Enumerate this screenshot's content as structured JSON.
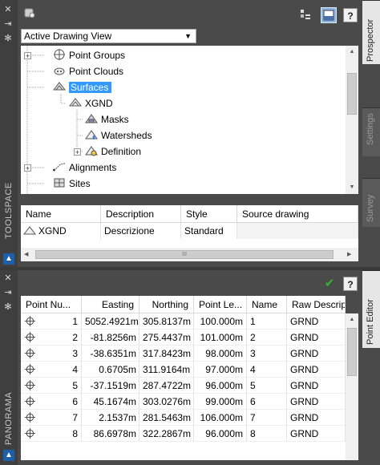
{
  "toolspace": {
    "side_label": "TOOLSPACE",
    "view_select": "Active Drawing View",
    "tabs": [
      "Prospector",
      "Settings",
      "Survey"
    ],
    "tree": [
      {
        "label": "Point Groups",
        "icon": "point-groups-icon"
      },
      {
        "label": "Point Clouds",
        "icon": "point-clouds-icon"
      },
      {
        "label": "Surfaces",
        "icon": "surfaces-icon",
        "selected": true
      },
      {
        "label": "XGND",
        "icon": "surface-icon"
      },
      {
        "label": "Masks",
        "icon": "masks-icon"
      },
      {
        "label": "Watersheds",
        "icon": "watersheds-icon"
      },
      {
        "label": "Definition",
        "icon": "definition-icon"
      },
      {
        "label": "Alignments",
        "icon": "alignments-icon"
      },
      {
        "label": "Sites",
        "icon": "sites-icon"
      }
    ],
    "list": {
      "headers": [
        "Name",
        "Description",
        "Style",
        "Source drawing"
      ],
      "row": {
        "name": "XGND",
        "description": "Descrizione",
        "style": "Standard",
        "source": ""
      }
    }
  },
  "panorama": {
    "side_label": "PANORAMA",
    "tab": "Point Editor",
    "headers": [
      "Point Nu...",
      "Easting",
      "Northing",
      "Point Le...",
      "Name",
      "Raw Descript"
    ],
    "rows": [
      [
        "1",
        "5052.4921m",
        "305.8137m",
        "100.000m",
        "1",
        "GRND"
      ],
      [
        "2",
        "-81.8256m",
        "275.4437m",
        "101.000m",
        "2",
        "GRND"
      ],
      [
        "3",
        "-38.6351m",
        "317.8423m",
        "98.000m",
        "3",
        "GRND"
      ],
      [
        "4",
        "0.6705m",
        "311.9164m",
        "97.000m",
        "4",
        "GRND"
      ],
      [
        "5",
        "-37.1519m",
        "287.4722m",
        "96.000m",
        "5",
        "GRND"
      ],
      [
        "6",
        "45.1674m",
        "303.0276m",
        "99.000m",
        "6",
        "GRND"
      ],
      [
        "7",
        "2.1537m",
        "281.5463m",
        "106.000m",
        "7",
        "GRND"
      ],
      [
        "8",
        "86.6978m",
        "322.2867m",
        "96.000m",
        "8",
        "GRND"
      ]
    ]
  },
  "icons": {
    "help": "?",
    "checkmark": "✔"
  },
  "colors": {
    "selection": "#3399ff",
    "help_check": "#2e9e2e"
  }
}
